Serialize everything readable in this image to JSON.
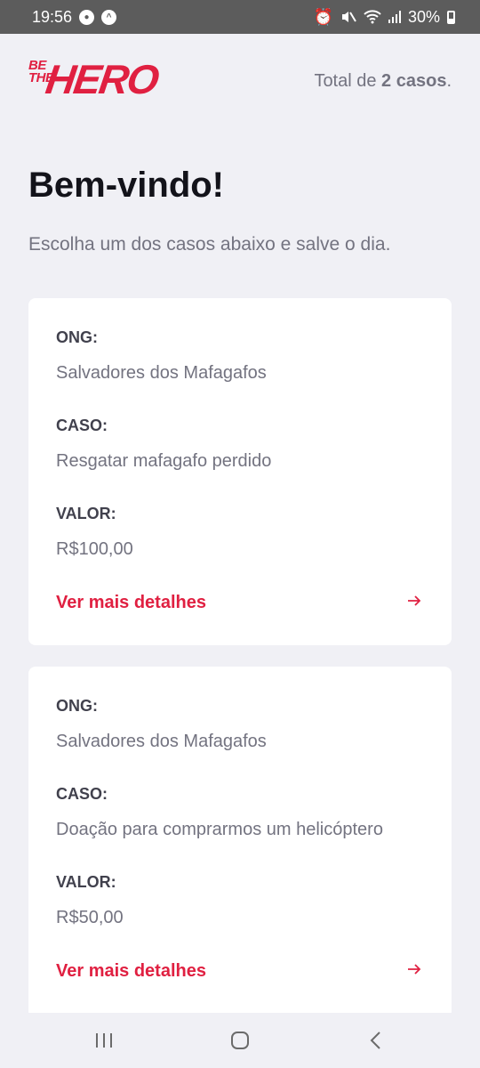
{
  "status_bar": {
    "time": "19:56",
    "battery": "30%",
    "icons": [
      "alarm-icon",
      "mute-icon",
      "wifi-icon",
      "signal-icon",
      "battery-icon"
    ]
  },
  "header": {
    "logo_top": "BE THE",
    "logo_main": "HERO",
    "total_prefix": "Total de ",
    "total_count": "2 casos",
    "total_suffix": "."
  },
  "welcome": {
    "title": "Bem-vindo!",
    "subtitle": "Escolha um dos casos abaixo e salve o dia."
  },
  "labels": {
    "ong": "ONG:",
    "caso": "CASO:",
    "valor": "VALOR:",
    "details": "Ver mais detalhes"
  },
  "incidents": [
    {
      "ong": "Salvadores dos Mafagafos",
      "caso": "Resgatar mafagafo perdido",
      "valor": "R$100,00"
    },
    {
      "ong": "Salvadores dos Mafagafos",
      "caso": "Doação para comprarmos um helicóptero",
      "valor": "R$50,00"
    }
  ],
  "colors": {
    "brand": "#e02041",
    "background": "#f0f0f5",
    "text_dark": "#13131a",
    "text_muted": "#737380"
  }
}
